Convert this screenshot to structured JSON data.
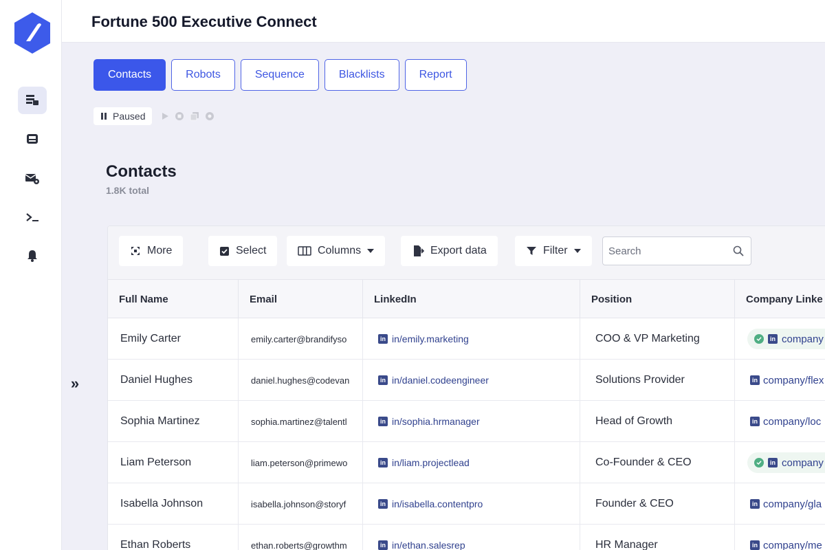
{
  "app": {
    "title": "Fortune 500 Executive Connect"
  },
  "tabs": [
    {
      "label": "Contacts",
      "active": true
    },
    {
      "label": "Robots",
      "active": false
    },
    {
      "label": "Sequence",
      "active": false
    },
    {
      "label": "Blacklists",
      "active": false
    },
    {
      "label": "Report",
      "active": false
    }
  ],
  "status": {
    "label": "Paused"
  },
  "section": {
    "title": "Contacts",
    "subtitle": "1.8K total"
  },
  "toolbar": {
    "more": "More",
    "select": "Select",
    "columns": "Columns",
    "export": "Export data",
    "filter": "Filter",
    "search_placeholder": "Search"
  },
  "table": {
    "columns": [
      "Full Name",
      "Email",
      "LinkedIn",
      "Position",
      "Company Linke"
    ],
    "rows": [
      {
        "name": "Emily Carter",
        "email": "emily.carter@brandifyso",
        "linkedin": "in/emily.marketing",
        "position": "COO & VP Marketing",
        "company": "company",
        "verified": true
      },
      {
        "name": "Daniel Hughes",
        "email": "daniel.hughes@codevan",
        "linkedin": "in/daniel.codeengineer",
        "position": "Solutions Provider",
        "company": "company/flex",
        "verified": false
      },
      {
        "name": "Sophia Martinez",
        "email": "sophia.martinez@talentl",
        "linkedin": "in/sophia.hrmanager",
        "position": "Head of Growth",
        "company": "company/loc",
        "verified": false
      },
      {
        "name": "Liam Peterson",
        "email": "liam.peterson@primewo",
        "linkedin": "in/liam.projectlead",
        "position": "Co-Founder & CEO",
        "company": "company",
        "verified": true
      },
      {
        "name": "Isabella Johnson",
        "email": "isabella.johnson@storyf",
        "linkedin": "in/isabella.contentpro",
        "position": "Founder & CEO",
        "company": "company/gla",
        "verified": false
      },
      {
        "name": "Ethan Roberts",
        "email": "ethan.roberts@growthm",
        "linkedin": "in/ethan.salesrep",
        "position": "HR Manager",
        "company": "company/me",
        "verified": false
      }
    ]
  },
  "colors": {
    "accent": "#3b57ea",
    "sidebar_active": "#e6e8f6",
    "verified": "#4fae83"
  }
}
